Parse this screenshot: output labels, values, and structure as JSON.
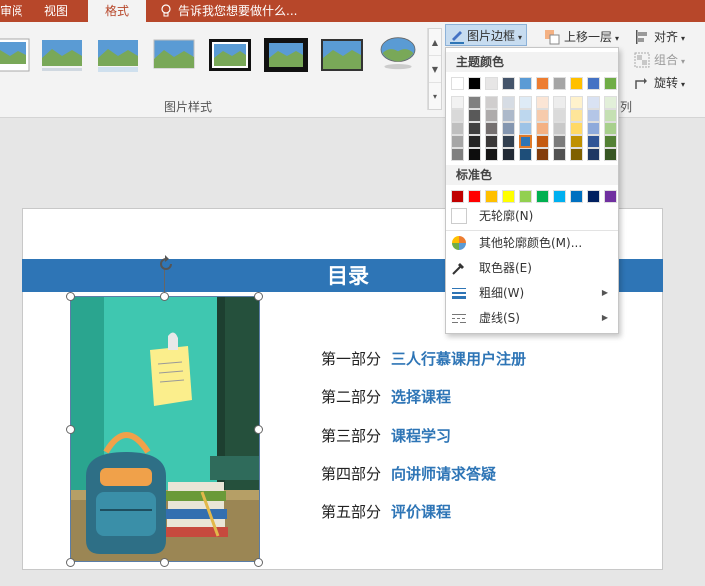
{
  "tabs": {
    "review": "审阅",
    "view": "视图",
    "format": "格式"
  },
  "tell_me": "告诉我您想要做什么...",
  "ribbon": {
    "picture_styles_label": "图片样式",
    "picture_border": "图片边框",
    "bring_forward": "上移一层",
    "align": "对齐",
    "group": "组合",
    "rotate": "旋转",
    "arrange_label_fragment": "列"
  },
  "dropdown": {
    "theme_colors": "主题颜色",
    "standard_colors": "标准色",
    "no_outline": "无轮廓(N)",
    "more_colors": "其他轮廓颜色(M)...",
    "eyedropper": "取色器(E)",
    "weight": "粗细(W)",
    "dashes": "虚线(S)",
    "theme_top": [
      "#ffffff",
      "#000000",
      "#e7e6e6",
      "#44546a",
      "#5b9bd5",
      "#ed7d31",
      "#a5a5a5",
      "#ffc000",
      "#4472c4",
      "#70ad47"
    ],
    "theme_shades": [
      [
        "#f2f2f2",
        "#808080",
        "#d0cece",
        "#d6dce4",
        "#deebf6",
        "#fbe5d5",
        "#ededed",
        "#fff2cc",
        "#d9e2f3",
        "#e2efd9"
      ],
      [
        "#d9d9d9",
        "#595959",
        "#aeabab",
        "#adb9ca",
        "#bdd7ee",
        "#f7cbac",
        "#dbdbdb",
        "#fee599",
        "#b4c6e7",
        "#c5e0b3"
      ],
      [
        "#bfbfbf",
        "#404040",
        "#757070",
        "#8496b0",
        "#9dc3e6",
        "#f4b183",
        "#c9c9c9",
        "#ffd965",
        "#8eaadb",
        "#a8d08d"
      ],
      [
        "#a6a6a6",
        "#262626",
        "#3a3838",
        "#323f4f",
        "#2e75b5",
        "#c55a11",
        "#7b7b7b",
        "#bf9000",
        "#2f5496",
        "#538135"
      ],
      [
        "#808080",
        "#0d0d0d",
        "#171616",
        "#222a35",
        "#1e4e79",
        "#833c0b",
        "#525252",
        "#7f6000",
        "#1f3864",
        "#375623"
      ]
    ],
    "standard": [
      "#c00000",
      "#ff0000",
      "#ffc000",
      "#ffff00",
      "#92d050",
      "#00b050",
      "#00b0f0",
      "#0070c0",
      "#002060",
      "#7030a0"
    ]
  },
  "slide": {
    "title": "目录",
    "items": [
      {
        "label": "第一部分",
        "value": "三人行慕课用户注册"
      },
      {
        "label": "第二部分",
        "value": "选择课程"
      },
      {
        "label": "第三部分",
        "value": "课程学习"
      },
      {
        "label": "第四部分",
        "value": "向讲师请求答疑"
      },
      {
        "label": "第五部分",
        "value": "评价课程"
      }
    ]
  },
  "colors": {
    "accent": "#b7472a",
    "slide_blue": "#2e75b6"
  },
  "icons": [
    "lightbulb-icon",
    "picture-border-icon",
    "bring-forward-icon",
    "align-icon",
    "group-icon",
    "rotate-icon",
    "color-wheel-icon",
    "eyedropper-icon",
    "line-weight-icon",
    "dashes-icon",
    "submenu-arrow-icon",
    "rotate-handle-icon"
  ]
}
